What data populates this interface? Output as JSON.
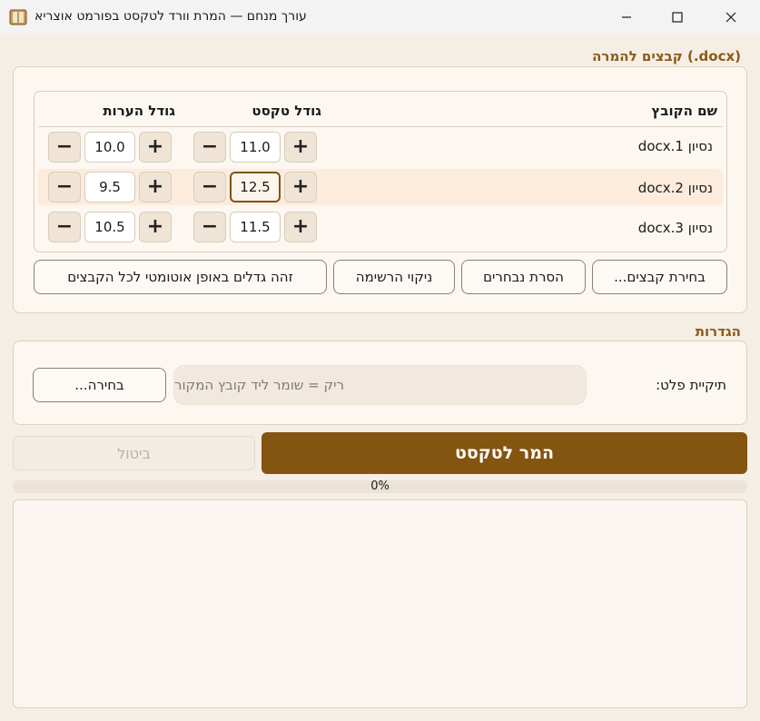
{
  "window": {
    "title": "עורך מנחם — המרת וורד לטקסט בפורמט אוצריא",
    "icon": "book-app-icon"
  },
  "files_group": {
    "title": "קבצים להמרה (.docx)",
    "columns": [
      "שם הקובץ",
      "גודל טקסט",
      "גודל הערות"
    ],
    "rows": [
      {
        "name": "נסיון 1.docx",
        "text_size": "11.0",
        "notes_size": "10.0"
      },
      {
        "name": "נסיון 2.docx",
        "text_size": "12.5",
        "notes_size": "9.5"
      },
      {
        "name": "נסיון 3.docx",
        "text_size": "11.5",
        "notes_size": "10.5"
      }
    ],
    "selected_row": 1,
    "buttons": {
      "select_files": "בחירת קבצים...",
      "remove_selected": "הסרת נבחרים",
      "clear_list": "ניקוי הרשימה",
      "auto_detect": "זהה גדלים באופן אוטומטי לכל הקבצים"
    }
  },
  "settings_group": {
    "title": "הגדרות",
    "output_label": "תיקיית פלט:",
    "output_placeholder": "ריק = שומר ליד קובץ המקור",
    "browse": "בחירה..."
  },
  "actions": {
    "convert": "המר לטקסט",
    "cancel": "ביטול"
  },
  "progress": {
    "value": 0,
    "text": "0%"
  },
  "colors": {
    "accent": "#845411",
    "accent_text": "#8a5a17",
    "row_highlight": "#fdecdc"
  }
}
